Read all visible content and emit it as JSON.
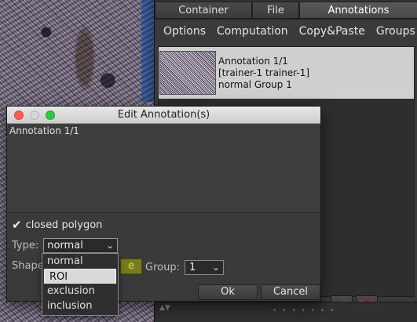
{
  "tabs": [
    "Container",
    "File",
    "Annotations"
  ],
  "menu": [
    "Options",
    "Computation",
    "Copy&Paste",
    "Groups"
  ],
  "annotation_list": [
    {
      "lines": [
        "Annotation 1/1",
        "[trainer-1 trainer-1]",
        "normal Group 1"
      ]
    }
  ],
  "dialog": {
    "title": "Edit Annotation(s)",
    "text": "Annotation 1/1",
    "closed_polygon_label": "closed polygon",
    "closed_polygon_checked": true,
    "type_label": "Type:",
    "type_value": "normal",
    "shape_label": "Shape",
    "shape_button_label": "e",
    "group_label": "Group:",
    "group_value": "1",
    "ok_label": "Ok",
    "cancel_label": "Cancel",
    "type_options": [
      "normal",
      "ROI",
      "exclusion",
      "inclusion"
    ],
    "type_highlighted": "ROI"
  },
  "icons": [
    "pencil-icon",
    "delete-x-icon",
    "grip-icon",
    "arrow-updown-icon"
  ],
  "colors": {
    "delete": "#d42020",
    "pencil": "#e8b830",
    "shape_button": "#7a7a1e"
  }
}
